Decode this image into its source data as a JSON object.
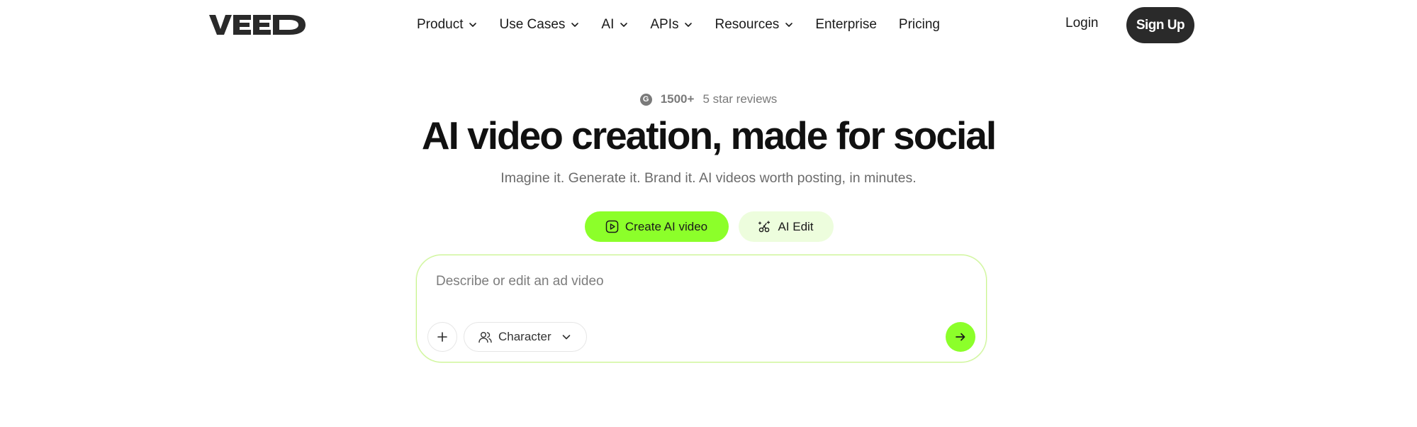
{
  "brand": {
    "logo_text": "VEED"
  },
  "nav": {
    "items": [
      {
        "label": "Product",
        "dropdown": true
      },
      {
        "label": "Use Cases",
        "dropdown": true
      },
      {
        "label": "AI",
        "dropdown": true
      },
      {
        "label": "APIs",
        "dropdown": true
      },
      {
        "label": "Resources",
        "dropdown": true
      },
      {
        "label": "Enterprise",
        "dropdown": false
      },
      {
        "label": "Pricing",
        "dropdown": false
      }
    ],
    "login_label": "Login",
    "signup_label": "Sign Up"
  },
  "hero": {
    "reviews_icon": "G",
    "reviews_count": "1500+",
    "reviews_text": "5 star reviews",
    "headline": "AI video creation, made for social",
    "subheadline": "Imagine it. Generate it. Brand it. AI videos worth posting, in minutes."
  },
  "modes": {
    "create_label": "Create AI video",
    "edit_label": "AI Edit",
    "active": "create"
  },
  "prompt": {
    "placeholder": "Describe or edit an ad video",
    "value": "",
    "character_label": "Character"
  },
  "colors": {
    "accent": "#8cff2a",
    "accent_light": "#edfddd",
    "dark": "#2a2a2a",
    "border": "#c9f58e"
  },
  "icons": {
    "reviews": "g-review-icon",
    "create": "play-square-icon",
    "edit": "magic-scissors-icon",
    "add": "plus-icon",
    "character": "people-icon",
    "dropdown": "chevron-down-icon",
    "submit": "arrow-right-icon"
  }
}
